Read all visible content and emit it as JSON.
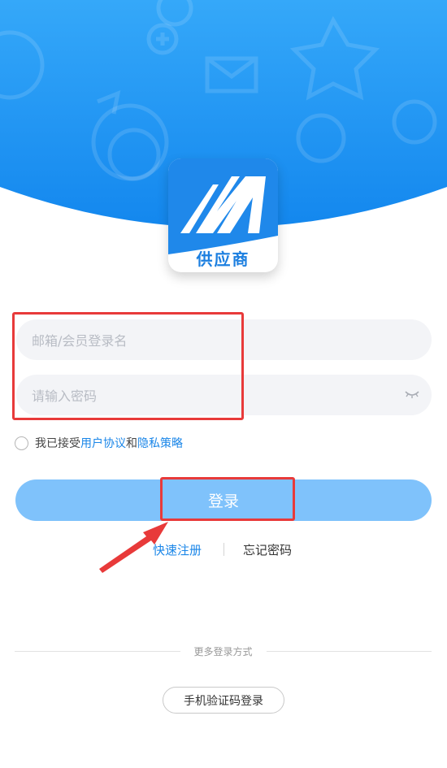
{
  "logo": {
    "label": "供应商"
  },
  "form": {
    "email_placeholder": "邮箱/会员登录名",
    "password_placeholder": "请输入密码"
  },
  "agreement": {
    "prefix": "我已接受",
    "user_agreement": "用户协议",
    "conjunction": "和",
    "privacy_policy": "隐私策略"
  },
  "login_button": "登录",
  "links": {
    "quick_register": "快速注册",
    "forgot_password": "忘记密码"
  },
  "more_login": {
    "label": "更多登录方式",
    "sms_button": "手机验证码登录"
  },
  "colors": {
    "header_blue": "#1e8ef0",
    "link_blue": "#1a86e8",
    "login_button": "#7fc2fb",
    "highlight_red": "#e83a3a"
  }
}
